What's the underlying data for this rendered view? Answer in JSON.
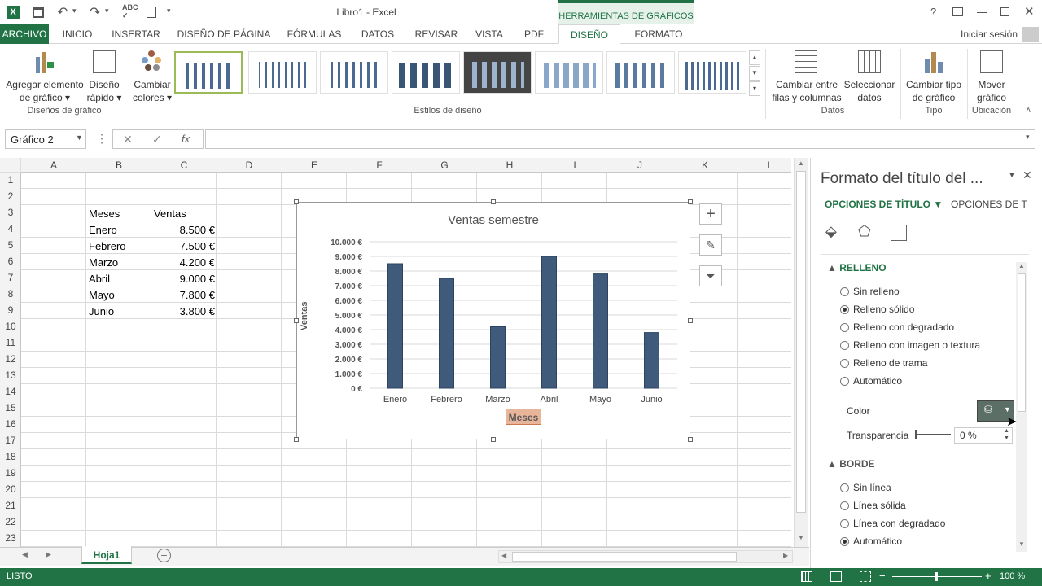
{
  "window": {
    "title": "Libro1 - Excel",
    "context_tab_group": "HERRAMIENTAS DE GRÁFICOS",
    "help_label": "?",
    "sign_in": "Iniciar sesión"
  },
  "tabs": [
    {
      "label": "ARCHIVO"
    },
    {
      "label": "INICIO"
    },
    {
      "label": "INSERTAR"
    },
    {
      "label": "DISEÑO DE PÁGINA"
    },
    {
      "label": "FÓRMULAS"
    },
    {
      "label": "DATOS"
    },
    {
      "label": "REVISAR"
    },
    {
      "label": "VISTA"
    },
    {
      "label": "PDF"
    },
    {
      "label": "DISEÑO"
    },
    {
      "label": "FORMATO"
    }
  ],
  "ribbon": {
    "add_element": {
      "line1": "Agregar elemento",
      "line2": "de gráfico"
    },
    "quick_layout": {
      "line1": "Diseño",
      "line2": "rápido"
    },
    "change_colors": {
      "line1": "Cambiar",
      "line2": "colores"
    },
    "group_layouts": "Diseños de gráfico",
    "group_styles": "Estilos de diseño",
    "switch_row_col": {
      "line1": "Cambiar entre",
      "line2": "filas y columnas"
    },
    "select_data": {
      "line1": "Seleccionar",
      "line2": "datos"
    },
    "group_data": "Datos",
    "change_type": {
      "line1": "Cambiar tipo",
      "line2": "de gráfico"
    },
    "group_type": "Tipo",
    "move_chart": {
      "line1": "Mover",
      "line2": "gráfico"
    },
    "group_location": "Ubicación"
  },
  "formula_bar": {
    "name_box": "Gráfico 2",
    "fx": "fx",
    "value": ""
  },
  "columns": [
    "A",
    "B",
    "C",
    "D",
    "E",
    "F",
    "G",
    "H",
    "I",
    "J",
    "K",
    "L"
  ],
  "rows": [
    "1",
    "2",
    "3",
    "4",
    "5",
    "6",
    "7",
    "8",
    "9",
    "10",
    "11",
    "12",
    "13",
    "14",
    "15",
    "16",
    "17",
    "18",
    "19",
    "20",
    "21",
    "22",
    "23"
  ],
  "table": {
    "header": {
      "months": "Meses",
      "sales": "Ventas"
    },
    "rows": [
      {
        "month": "Enero",
        "sales": "8.500 €"
      },
      {
        "month": "Febrero",
        "sales": "7.500 €"
      },
      {
        "month": "Marzo",
        "sales": "4.200 €"
      },
      {
        "month": "Abril",
        "sales": "9.000 €"
      },
      {
        "month": "Mayo",
        "sales": "7.800 €"
      },
      {
        "month": "Junio",
        "sales": "3.800 €"
      }
    ]
  },
  "chart_data": {
    "type": "bar",
    "title": "Ventas semestre",
    "xlabel": "Meses",
    "ylabel": "Ventas",
    "categories": [
      "Enero",
      "Febrero",
      "Marzo",
      "Abril",
      "Mayo",
      "Junio"
    ],
    "values": [
      8500,
      7500,
      4200,
      9000,
      7800,
      3800
    ],
    "ylim": [
      0,
      10000
    ],
    "yticks": [
      "0 €",
      "1.000 €",
      "2.000 €",
      "3.000 €",
      "4.000 €",
      "5.000 €",
      "6.000 €",
      "7.000 €",
      "8.000 €",
      "9.000 €",
      "10.000 €"
    ],
    "grid": true,
    "bar_color": "#3f5a7a"
  },
  "pane": {
    "title": "Formato del título del ...",
    "tab_title_options": "OPCIONES DE TÍTULO",
    "tab_text_options": "OPCIONES DE T",
    "fill_section": "RELLENO",
    "fill_options": [
      {
        "label": "Sin relleno",
        "checked": false
      },
      {
        "label": "Relleno sólido",
        "checked": true
      },
      {
        "label": "Relleno con degradado",
        "checked": false
      },
      {
        "label": "Relleno con imagen o textura",
        "checked": false
      },
      {
        "label": "Relleno de trama",
        "checked": false
      },
      {
        "label": "Automático",
        "checked": false
      }
    ],
    "color_label": "Color",
    "transparency_label": "Transparencia",
    "transparency_value": "0 %",
    "border_section": "BORDE",
    "border_options": [
      {
        "label": "Sin línea",
        "checked": false
      },
      {
        "label": "Línea sólida",
        "checked": false
      },
      {
        "label": "Línea con degradado",
        "checked": false
      },
      {
        "label": "Automático",
        "checked": true
      }
    ]
  },
  "sheet_tab": "Hoja1",
  "status": {
    "ready": "LISTO",
    "zoom": "100 %"
  },
  "colors": {
    "excel_green": "#217346",
    "accent_green": "#217346",
    "title_selected_fill": "#e8b59a"
  }
}
